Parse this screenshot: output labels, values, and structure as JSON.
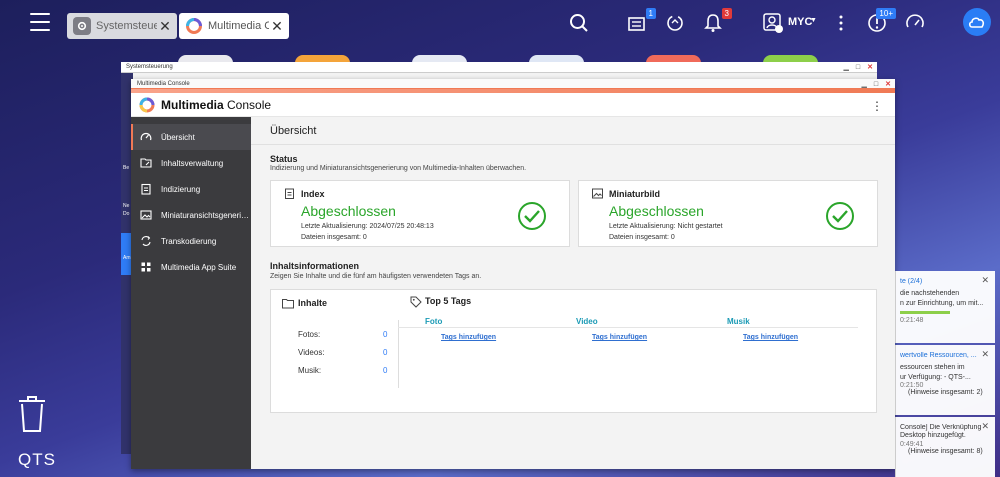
{
  "taskbar": {
    "tabs": [
      {
        "label": "Systemsteue...",
        "active": false
      },
      {
        "label": "Multimedia C...",
        "active": true
      }
    ],
    "notifications_badge": "1",
    "alerts_badge": "3",
    "user_label": "MYC",
    "updates_badge": "10+"
  },
  "sys_window": {
    "title": "Systemsteuerung",
    "left_labels": [
      "Be",
      "Ne",
      "Do",
      "Am"
    ]
  },
  "window": {
    "title": "Multimedia Console",
    "app_title_bold": "Multimedia",
    "app_title_rest": " Console"
  },
  "sidebar": {
    "items": [
      {
        "label": "Übersicht",
        "icon": "gauge-icon"
      },
      {
        "label": "Inhaltsverwaltung",
        "icon": "folder-edit-icon"
      },
      {
        "label": "Indizierung",
        "icon": "clipboard-icon"
      },
      {
        "label": "Miniaturansichtsgenerieru...",
        "icon": "image-icon"
      },
      {
        "label": "Transkodierung",
        "icon": "transcode-icon"
      },
      {
        "label": "Multimedia App Suite",
        "icon": "grid-icon"
      }
    ]
  },
  "main": {
    "page_title": "Übersicht",
    "status": {
      "title": "Status",
      "subtitle": "Indizierung und Miniaturansichtsgenerierung von Multimedia-Inhalten überwachen.",
      "cards": [
        {
          "name": "Index",
          "state": "Abgeschlossen",
          "line1": "Letzte Aktualisierung:  2024/07/25 20:48:13",
          "line2": "Dateien insgesamt:  0"
        },
        {
          "name": "Miniaturbild",
          "state": "Abgeschlossen",
          "line1": "Letzte Aktualisierung:  Nicht gestartet",
          "line2": "Dateien insgesamt:  0"
        }
      ]
    },
    "content_info": {
      "title": "Inhaltsinformationen",
      "subtitle": "Zeigen Sie Inhalte und die fünf am häufigsten verwendeten Tags an.",
      "contents_title": "Inhalte",
      "rows": [
        {
          "label": "Fotos:",
          "value": "0"
        },
        {
          "label": "Videos:",
          "value": "0"
        },
        {
          "label": "Musik:",
          "value": "0"
        }
      ],
      "tags_title": "Top 5 Tags",
      "tag_columns": [
        {
          "label": "Foto",
          "link": "Tags hinzufügen"
        },
        {
          "label": "Video",
          "link": "Tags hinzufügen"
        },
        {
          "label": "Musik",
          "link": "Tags hinzufügen"
        }
      ]
    }
  },
  "notifications": [
    {
      "title": "te (2/4)",
      "lines": [
        "die nachstehenden",
        "n zur Einrichtung, um mit..."
      ],
      "time": "0:21:48"
    },
    {
      "title": "wertvolle Ressourcen, ...",
      "lines": [
        "essourcen stehen im",
        "ur Verfügung: - QTS-..."
      ],
      "time": "0:21:50",
      "footer": "(Hinweise insgesamt: 2)"
    },
    {
      "title": "Console] Die Verknüpfung",
      "lines": [
        "Desktop hinzugefügt."
      ],
      "time": "0:49:41",
      "footer": "(Hinweise insgesamt: 8)"
    }
  ],
  "desktop": {
    "brand": "QTS"
  }
}
